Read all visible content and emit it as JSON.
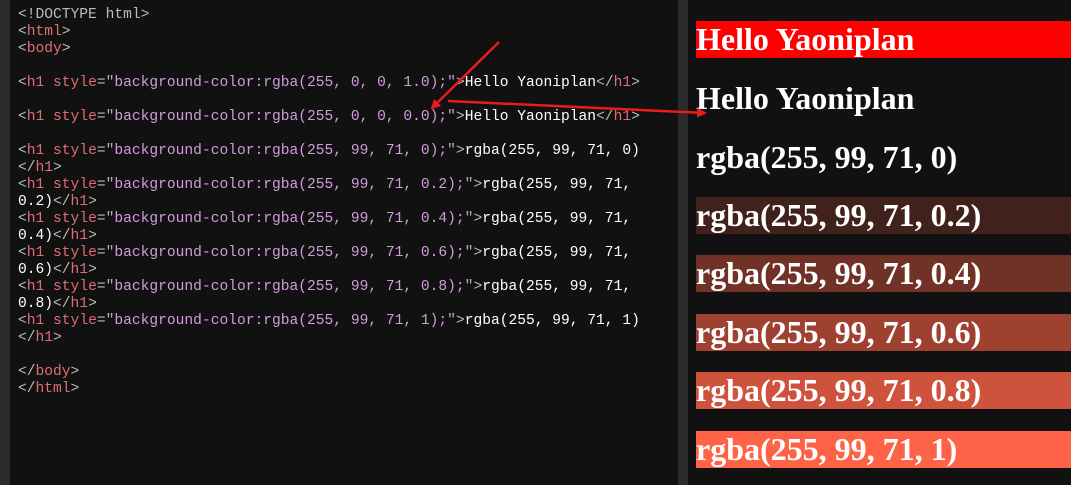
{
  "editor": {
    "lines": [
      [
        {
          "c": "doctype",
          "t": "<!DOCTYPE html>"
        }
      ],
      [
        {
          "c": "br",
          "t": "<"
        },
        {
          "c": "tag",
          "t": "html"
        },
        {
          "c": "br",
          "t": ">"
        }
      ],
      [
        {
          "c": "br",
          "t": "<"
        },
        {
          "c": "tag",
          "t": "body"
        },
        {
          "c": "br",
          "t": ">"
        }
      ],
      [],
      [
        {
          "c": "br",
          "t": "<"
        },
        {
          "c": "tag",
          "t": "h1"
        },
        {
          "c": "txt",
          "t": " "
        },
        {
          "c": "attr",
          "t": "style"
        },
        {
          "c": "br",
          "t": "="
        },
        {
          "c": "val",
          "t": "\"background-color:rgba(255, 0, 0, 1.0);\""
        },
        {
          "c": "br",
          "t": ">"
        },
        {
          "c": "txt",
          "t": "Hello Yaoniplan"
        },
        {
          "c": "br",
          "t": "</"
        },
        {
          "c": "tag",
          "t": "h1"
        },
        {
          "c": "br",
          "t": ">"
        }
      ],
      [],
      [
        {
          "c": "br",
          "t": "<"
        },
        {
          "c": "tag",
          "t": "h1"
        },
        {
          "c": "txt",
          "t": " "
        },
        {
          "c": "attr",
          "t": "style"
        },
        {
          "c": "br",
          "t": "="
        },
        {
          "c": "val",
          "t": "\"background-color:rgba(255, 0, 0, 0.0);\""
        },
        {
          "c": "br",
          "t": ">"
        },
        {
          "c": "txt",
          "t": "Hello Yaoniplan"
        },
        {
          "c": "br",
          "t": "</"
        },
        {
          "c": "tag",
          "t": "h1"
        },
        {
          "c": "br",
          "t": ">"
        }
      ],
      [],
      [
        {
          "c": "br",
          "t": "<"
        },
        {
          "c": "tag",
          "t": "h1"
        },
        {
          "c": "txt",
          "t": " "
        },
        {
          "c": "attr",
          "t": "style"
        },
        {
          "c": "br",
          "t": "="
        },
        {
          "c": "val",
          "t": "\"background-color:rgba(255, 99, 71, 0);\""
        },
        {
          "c": "br",
          "t": ">"
        },
        {
          "c": "txt",
          "t": "rgba(255, 99, 71, 0)"
        }
      ],
      [
        {
          "c": "br",
          "t": "</"
        },
        {
          "c": "tag",
          "t": "h1"
        },
        {
          "c": "br",
          "t": ">"
        }
      ],
      [
        {
          "c": "br",
          "t": "<"
        },
        {
          "c": "tag",
          "t": "h1"
        },
        {
          "c": "txt",
          "t": " "
        },
        {
          "c": "attr",
          "t": "style"
        },
        {
          "c": "br",
          "t": "="
        },
        {
          "c": "val",
          "t": "\"background-color:rgba(255, 99, 71, 0.2);\""
        },
        {
          "c": "br",
          "t": ">"
        },
        {
          "c": "txt",
          "t": "rgba(255, 99, 71,"
        }
      ],
      [
        {
          "c": "txt",
          "t": "0.2)"
        },
        {
          "c": "br",
          "t": "</"
        },
        {
          "c": "tag",
          "t": "h1"
        },
        {
          "c": "br",
          "t": ">"
        }
      ],
      [
        {
          "c": "br",
          "t": "<"
        },
        {
          "c": "tag",
          "t": "h1"
        },
        {
          "c": "txt",
          "t": " "
        },
        {
          "c": "attr",
          "t": "style"
        },
        {
          "c": "br",
          "t": "="
        },
        {
          "c": "val",
          "t": "\"background-color:rgba(255, 99, 71, 0.4);\""
        },
        {
          "c": "br",
          "t": ">"
        },
        {
          "c": "txt",
          "t": "rgba(255, 99, 71,"
        }
      ],
      [
        {
          "c": "txt",
          "t": "0.4)"
        },
        {
          "c": "br",
          "t": "</"
        },
        {
          "c": "tag",
          "t": "h1"
        },
        {
          "c": "br",
          "t": ">"
        }
      ],
      [
        {
          "c": "br",
          "t": "<"
        },
        {
          "c": "tag",
          "t": "h1"
        },
        {
          "c": "txt",
          "t": " "
        },
        {
          "c": "attr",
          "t": "style"
        },
        {
          "c": "br",
          "t": "="
        },
        {
          "c": "val",
          "t": "\"background-color:rgba(255, 99, 71, 0.6);\""
        },
        {
          "c": "br",
          "t": ">"
        },
        {
          "c": "txt",
          "t": "rgba(255, 99, 71,"
        }
      ],
      [
        {
          "c": "txt",
          "t": "0.6)"
        },
        {
          "c": "br",
          "t": "</"
        },
        {
          "c": "tag",
          "t": "h1"
        },
        {
          "c": "br",
          "t": ">"
        }
      ],
      [
        {
          "c": "br",
          "t": "<"
        },
        {
          "c": "tag",
          "t": "h1"
        },
        {
          "c": "txt",
          "t": " "
        },
        {
          "c": "attr",
          "t": "style"
        },
        {
          "c": "br",
          "t": "="
        },
        {
          "c": "val",
          "t": "\"background-color:rgba(255, 99, 71, 0.8);\""
        },
        {
          "c": "br",
          "t": ">"
        },
        {
          "c": "txt",
          "t": "rgba(255, 99, 71,"
        }
      ],
      [
        {
          "c": "txt",
          "t": "0.8)"
        },
        {
          "c": "br",
          "t": "</"
        },
        {
          "c": "tag",
          "t": "h1"
        },
        {
          "c": "br",
          "t": ">"
        }
      ],
      [
        {
          "c": "br",
          "t": "<"
        },
        {
          "c": "tag",
          "t": "h1"
        },
        {
          "c": "txt",
          "t": " "
        },
        {
          "c": "attr",
          "t": "style"
        },
        {
          "c": "br",
          "t": "="
        },
        {
          "c": "val",
          "t": "\"background-color:rgba(255, 99, 71, 1);\""
        },
        {
          "c": "br",
          "t": ">"
        },
        {
          "c": "txt",
          "t": "rgba(255, 99, 71, 1)"
        }
      ],
      [
        {
          "c": "br",
          "t": "</"
        },
        {
          "c": "tag",
          "t": "h1"
        },
        {
          "c": "br",
          "t": ">"
        }
      ],
      [],
      [
        {
          "c": "br",
          "t": "</"
        },
        {
          "c": "tag",
          "t": "body"
        },
        {
          "c": "br",
          "t": ">"
        }
      ],
      [
        {
          "c": "br",
          "t": "</"
        },
        {
          "c": "tag",
          "t": "html"
        },
        {
          "c": "br",
          "t": ">"
        }
      ]
    ]
  },
  "preview": {
    "headings": [
      {
        "text": "Hello Yaoniplan",
        "bg": "rgba(255, 0, 0, 1.0)"
      },
      {
        "text": "Hello Yaoniplan",
        "bg": "rgba(255, 0, 0, 0.0)"
      },
      {
        "text": "rgba(255, 99, 71, 0)",
        "bg": "rgba(255, 99, 71, 0)"
      },
      {
        "text": "rgba(255, 99, 71, 0.2)",
        "bg": "rgba(255, 99, 71, 0.2)"
      },
      {
        "text": "rgba(255, 99, 71, 0.4)",
        "bg": "rgba(255, 99, 71, 0.4)"
      },
      {
        "text": "rgba(255, 99, 71, 0.6)",
        "bg": "rgba(255, 99, 71, 0.6)"
      },
      {
        "text": "rgba(255, 99, 71, 0.8)",
        "bg": "rgba(255, 99, 71, 0.8)"
      },
      {
        "text": "rgba(255, 99, 71, 1)",
        "bg": "rgba(255, 99, 71, 1)"
      }
    ]
  },
  "annotation": {
    "arrow_color": "#e81c1c"
  }
}
